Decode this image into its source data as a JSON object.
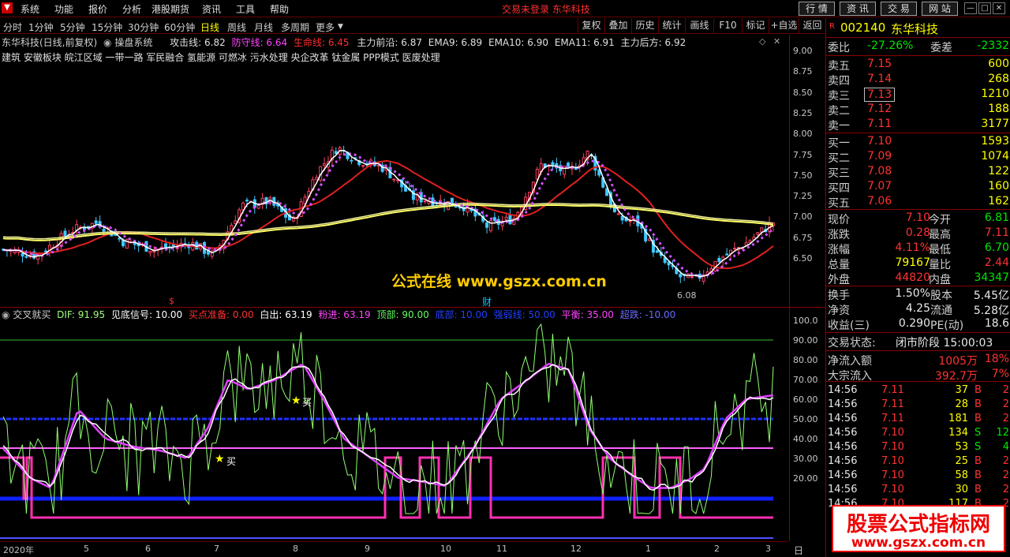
{
  "menu": {
    "items": [
      "系统",
      "功能",
      "报价",
      "分析",
      "港股期货",
      "资讯",
      "工具",
      "帮助"
    ],
    "login": "交易未登录",
    "company": "东华科技",
    "buttons": [
      "行 情",
      "资 讯",
      "交 易",
      "网 站"
    ]
  },
  "periods": {
    "items": [
      "分时",
      "1分钟",
      "5分钟",
      "15分钟",
      "30分钟",
      "60分钟",
      "日线",
      "周线",
      "月线",
      "多周期",
      "更多"
    ],
    "active": "日线"
  },
  "tools": [
    "复权",
    "叠加",
    "历史",
    "统计",
    "画线",
    "F10",
    "标记",
    "+自选",
    "返回"
  ],
  "main_info": {
    "title": "东华科技(日线,前复权)",
    "system": "操盘系统",
    "attack": "攻击线: 6.82",
    "defend": "防守线: 6.64",
    "life": "生命线: 6.45",
    "main": "主力前沿: 6.87",
    "ema9": "EMA9: 6.89",
    "ema10": "EMA10: 6.90",
    "ema11": "EMA11: 6.91",
    "after": "主力后方: 6.92"
  },
  "concepts": "建筑      安徽板块 皖江区域 一带一路 军民融合 氢能源 可燃冰 污水处理 央企改革 钛金属 PPP模式 医废处理",
  "watermark_center": "公式在线  www.gszx.com.cn",
  "low_label": "6.08",
  "markers": {
    "s": "$",
    "cai": "财",
    "buy": "买"
  },
  "price_axis": [
    "9.00",
    "8.75",
    "8.50",
    "8.25",
    "8.00",
    "7.75",
    "7.50",
    "7.25",
    "7.00",
    "6.75",
    "6.50"
  ],
  "ind_info": {
    "name": "交叉就买",
    "dif": "DIF: 91.95",
    "see_bottom": "见底信号: 10.00",
    "buy_prep": "买点准备: 0.00",
    "white_out": "白出: 63.19",
    "pink_in": "粉进: 63.19",
    "top": "顶部: 90.00",
    "bottom": "底部: 10.00",
    "strong_weak": "强弱线: 50.00",
    "balance": "平衡: 35.00",
    "oversold": "超跌: -10.00"
  },
  "ind_axis": [
    "100.0",
    "90.00",
    "80.00",
    "70.00",
    "60.00",
    "50.00",
    "40.00",
    "30.00",
    "20.00"
  ],
  "xaxis": [
    "2020年",
    "5",
    "6",
    "7",
    "8",
    "9",
    "10",
    "11",
    "12",
    "1",
    "2",
    "3"
  ],
  "xaxis_right": "日线",
  "quote": {
    "code": "002140",
    "name": "东华科技",
    "badge": "R",
    "wb_label": "委比",
    "wb": "-27.26%",
    "wc_label": "委差",
    "wc": "-2332",
    "asks": [
      {
        "l": "卖五",
        "p": "7.15",
        "v": "600"
      },
      {
        "l": "卖四",
        "p": "7.14",
        "v": "268"
      },
      {
        "l": "卖三",
        "p": "7.13",
        "v": "1210"
      },
      {
        "l": "卖二",
        "p": "7.12",
        "v": "188"
      },
      {
        "l": "卖一",
        "p": "7.11",
        "v": "3177"
      }
    ],
    "bids": [
      {
        "l": "买一",
        "p": "7.10",
        "v": "1593"
      },
      {
        "l": "买二",
        "p": "7.09",
        "v": "1074"
      },
      {
        "l": "买三",
        "p": "7.08",
        "v": "122"
      },
      {
        "l": "买四",
        "p": "7.07",
        "v": "160"
      },
      {
        "l": "买五",
        "p": "7.06",
        "v": "162"
      }
    ],
    "stats": [
      {
        "l1": "现价",
        "v1": "7.10",
        "c1": "red",
        "l2": "今开",
        "v2": "6.81",
        "c2": "grn"
      },
      {
        "l1": "涨跌",
        "v1": "0.28",
        "c1": "red",
        "l2": "最高",
        "v2": "7.11",
        "c2": "red"
      },
      {
        "l1": "涨幅",
        "v1": "4.11%",
        "c1": "red",
        "l2": "最低",
        "v2": "6.70",
        "c2": "grn"
      },
      {
        "l1": "总量",
        "v1": "79167",
        "c1": "yel",
        "l2": "量比",
        "v2": "2.44",
        "c2": "red"
      },
      {
        "l1": "外盘",
        "v1": "44820",
        "c1": "red",
        "l2": "内盘",
        "v2": "34347",
        "c2": "grn"
      }
    ],
    "stats2": [
      {
        "l1": "换手",
        "v1": "1.50%",
        "c1": "wht",
        "l2": "股本",
        "v2": "5.45亿",
        "c2": "wht"
      },
      {
        "l1": "净资",
        "v1": "4.25",
        "c1": "wht",
        "l2": "流通",
        "v2": "5.28亿",
        "c2": "wht"
      },
      {
        "l1": "收益(三)",
        "v1": "0.290",
        "c1": "wht",
        "l2": "PE(动)",
        "v2": "18.6",
        "c2": "wht"
      }
    ],
    "status_label": "交易状态:",
    "status": "闭市阶段 15:00:03",
    "flow": [
      {
        "l": "净流入额",
        "v": "1005万",
        "p": "18%"
      },
      {
        "l": "大宗流入",
        "v": "392.7万",
        "p": "7%"
      }
    ],
    "ticks": [
      {
        "t": "14:56",
        "p": "7.11",
        "v": "37",
        "d": "B",
        "n": "2"
      },
      {
        "t": "14:56",
        "p": "7.11",
        "v": "28",
        "d": "B",
        "n": "2"
      },
      {
        "t": "14:56",
        "p": "7.11",
        "v": "181",
        "d": "B",
        "n": "2"
      },
      {
        "t": "14:56",
        "p": "7.10",
        "v": "134",
        "d": "S",
        "n": "12"
      },
      {
        "t": "14:56",
        "p": "7.10",
        "v": "53",
        "d": "S",
        "n": "4"
      },
      {
        "t": "14:56",
        "p": "7.10",
        "v": "25",
        "d": "B",
        "n": "2"
      },
      {
        "t": "14:56",
        "p": "7.10",
        "v": "58",
        "d": "B",
        "n": "2"
      },
      {
        "t": "14:56",
        "p": "7.10",
        "v": "30",
        "d": "B",
        "n": "2"
      },
      {
        "t": "14:56",
        "p": "7.10",
        "v": "117",
        "d": "B",
        "n": "2"
      }
    ]
  },
  "footer_watermark": {
    "title": "股票公式指标网",
    "url": "www.gszx.com.cn"
  }
}
